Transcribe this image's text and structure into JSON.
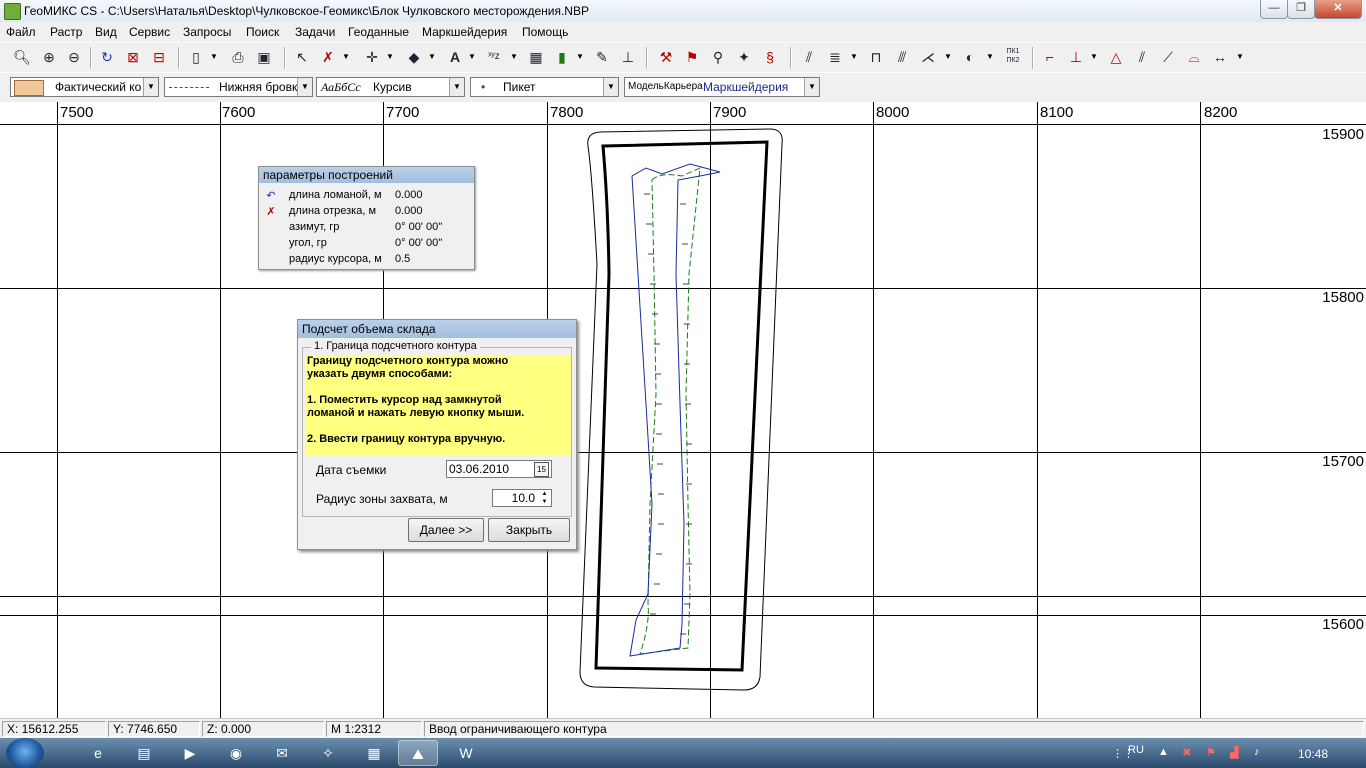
{
  "window": {
    "title": "ГеоМИКС CS - C:\\Users\\Наталья\\Desktop\\Чулковское-Геомикс\\Блок Чулковского месторождения.NBP",
    "minimize": "—",
    "maximize": "❐",
    "close": "✕"
  },
  "menu": [
    "Файл",
    "Растр",
    "Вид",
    "Сервис",
    "Запросы",
    "Поиск",
    "Задачи",
    "Геоданные",
    "Маркшейдерия",
    "Помощь"
  ],
  "toolbar2": {
    "fill_style": "Фактический ко",
    "line_style": "Нижняя бровка",
    "font_sample": "АаБбСс",
    "font_name": "Курсив",
    "point_style": "Пикет",
    "model_prefix": "МодельКарьера",
    "model_name": "Маркшейдерия"
  },
  "icons": {
    "zoom": "magnifier-icon",
    "pk_label_1": "ПК1",
    "pk_label_2": "ПК2"
  },
  "ruler": {
    "x_labels": [
      "7500",
      "7600",
      "7700",
      "7800",
      "7900",
      "8000",
      "8100",
      "8200"
    ],
    "y_labels": [
      "15900",
      "15800",
      "15700",
      "15600"
    ]
  },
  "params_panel": {
    "title": "параметры построений",
    "rows": [
      {
        "label": "длина ломаной, м",
        "value": "0.000",
        "icon": "polyline-icon"
      },
      {
        "label": "длина отрезка, м",
        "value": "0.000",
        "icon": "segment-icon"
      },
      {
        "label": "азимут, гр",
        "value": "0° 00' 00''",
        "icon": ""
      },
      {
        "label": "угол, гр",
        "value": "0° 00' 00''",
        "icon": ""
      },
      {
        "label": "радиус курсора, м",
        "value": "0.5",
        "icon": ""
      }
    ]
  },
  "dialog": {
    "title": "Подсчет объема склада",
    "group_label": "1. Граница подсчетного контура",
    "info_lines": [
      "Границу подсчетного контура можно",
      "указать двумя способами:",
      "",
      "1. Поместить курсор над замкнутой",
      "ломаной и нажать левую кнопку мыши.",
      "",
      "2. Ввести границу контура вручную."
    ],
    "date_label": "Дата съемки",
    "date_value": "03.06.2010",
    "calendar_btn": "15",
    "radius_label": "Радиус зоны захвата, м",
    "radius_value": "10.0",
    "next_button": "Далее >>",
    "close_button": "Закрыть"
  },
  "status": {
    "x": "X: 15612.255",
    "y": "Y: 7746.650",
    "z": "Z: 0.000",
    "scale": "M 1:2312",
    "message": "Ввод ограничивающего контура"
  },
  "taskbar": {
    "lang": "RU",
    "time": "10:48"
  }
}
